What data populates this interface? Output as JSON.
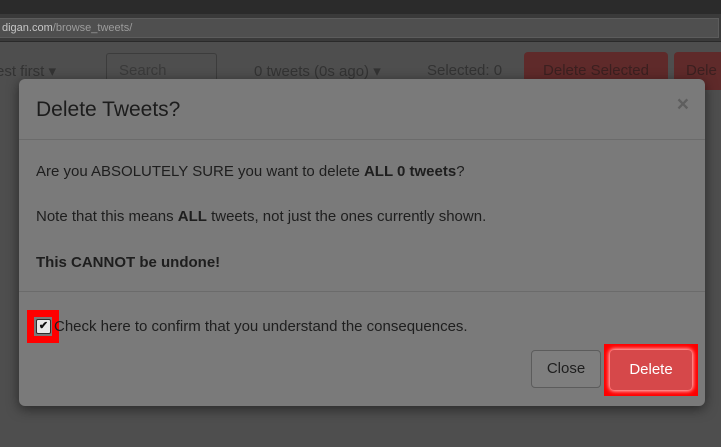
{
  "browser": {
    "url_domain": "digan.com",
    "url_path": "/browse_tweets/"
  },
  "toolbar": {
    "sort_label": "est first ▾",
    "search_placeholder": "Search",
    "tweet_count_label": "0 tweets (0s ago) ▾",
    "selected_label": "Selected: 0",
    "delete_selected_label": "Delete Selected",
    "delete_all_label": "Dele"
  },
  "modal": {
    "title": "Delete Tweets?",
    "close_symbol": "×",
    "line1_prefix": "Are you ABSOLUTELY SURE you want to delete ",
    "line1_bold": "ALL 0 tweets",
    "line1_suffix": "?",
    "line2_prefix": "Note that this means ",
    "line2_bold": "ALL",
    "line2_suffix": " tweets, not just the ones currently shown.",
    "line3_bold": "This CANNOT be undone!",
    "confirm_label": "Check here to confirm that you understand the consequences.",
    "confirm_checked": true,
    "close_button": "Close",
    "delete_button": "Delete"
  },
  "colors": {
    "highlight": "#ff0000",
    "delete_button": "#d6484a"
  }
}
